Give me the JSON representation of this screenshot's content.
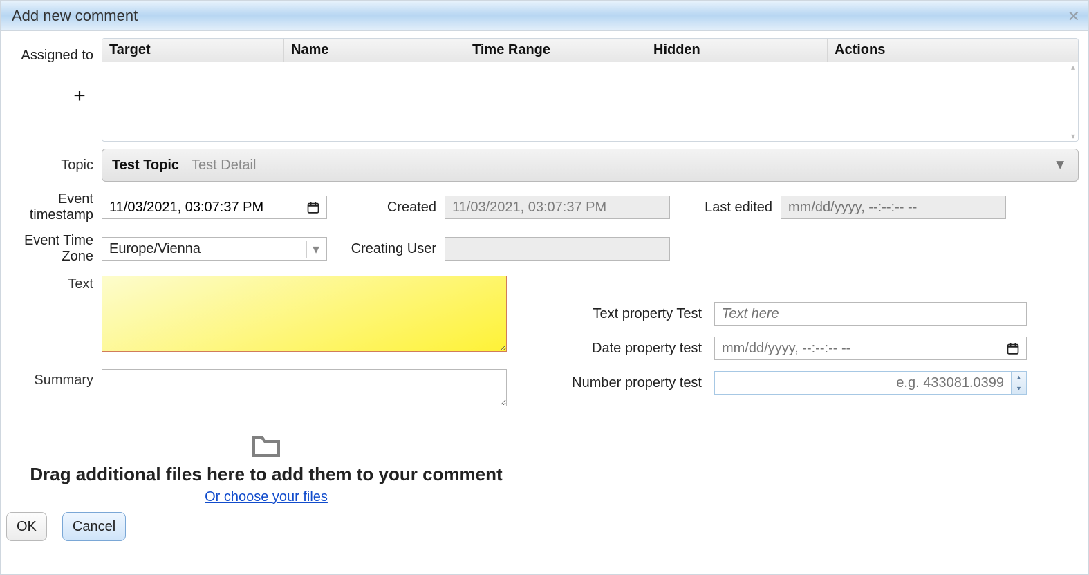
{
  "dialog": {
    "title": "Add new comment",
    "close_tooltip": "Close"
  },
  "labels": {
    "assigned_to": "Assigned to",
    "topic": "Topic",
    "event_timestamp_l1": "Event",
    "event_timestamp_l2": "timestamp",
    "event_tz_l1": "Event Time",
    "event_tz_l2": "Zone",
    "created": "Created",
    "last_edited": "Last edited",
    "creating_user": "Creating User",
    "text": "Text",
    "summary": "Summary",
    "text_property": "Text property Test",
    "date_property": "Date property test",
    "number_property": "Number property test"
  },
  "grid": {
    "columns": {
      "target": "Target",
      "name": "Name",
      "time_range": "Time Range",
      "hidden": "Hidden",
      "actions": "Actions"
    },
    "rows": []
  },
  "topic": {
    "name": "Test Topic",
    "detail": "Test Detail"
  },
  "values": {
    "event_timestamp": "11/03/2021, 03:07:37 PM",
    "created": "11/03/2021, 03:07:37 PM",
    "last_edited_placeholder": "mm/dd/yyyy, --:--:-- --",
    "timezone": "Europe/Vienna",
    "creating_user": "",
    "text": "",
    "summary": "",
    "text_property_placeholder": "Text here",
    "text_property_value": "",
    "date_property_placeholder": "mm/dd/yyyy, --:--:-- --",
    "date_property_value": "",
    "number_property_placeholder": "e.g. 433081.0399",
    "number_property_value": ""
  },
  "dropzone": {
    "text": "Drag additional files here to add them to your comment",
    "link": "Or choose your files"
  },
  "buttons": {
    "ok": "OK",
    "cancel": "Cancel",
    "plus": "+"
  }
}
